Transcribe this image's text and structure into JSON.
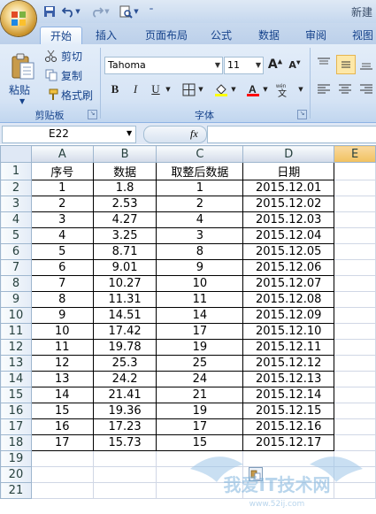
{
  "title_bar": {
    "title_partial": "新建"
  },
  "tabs": [
    {
      "label": "开始",
      "active": true
    },
    {
      "label": "插入"
    },
    {
      "label": "页面布局"
    },
    {
      "label": "公式"
    },
    {
      "label": "数据"
    },
    {
      "label": "审阅"
    },
    {
      "label": "视图"
    }
  ],
  "clipboard": {
    "paste_label": "粘贴",
    "cut_label": "剪切",
    "copy_label": "复制",
    "format_painter_label": "格式刷",
    "group_label": "剪贴板"
  },
  "font": {
    "name": "Tahoma",
    "size": "11",
    "group_label": "字体",
    "bold": "B",
    "italic": "I",
    "underline": "U",
    "font_color": "#ff0000",
    "fill_color": "#ffff00"
  },
  "formula_bar": {
    "name_box": "E22",
    "fx": "fx",
    "value": ""
  },
  "columns": [
    "A",
    "B",
    "C",
    "D",
    "E"
  ],
  "selected_column": "E",
  "row_numbers": [
    "1",
    "2",
    "3",
    "4",
    "5",
    "6",
    "7",
    "8",
    "9",
    "10",
    "11",
    "12",
    "13",
    "14",
    "15",
    "16",
    "17",
    "18",
    "19",
    "20",
    "21"
  ],
  "table": {
    "headers": [
      "序号",
      "数据",
      "取整后数据",
      "日期"
    ],
    "rows": [
      [
        "1",
        "1.8",
        "1",
        "2015.12.01"
      ],
      [
        "2",
        "2.53",
        "2",
        "2015.12.02"
      ],
      [
        "3",
        "4.27",
        "4",
        "2015.12.03"
      ],
      [
        "4",
        "3.25",
        "3",
        "2015.12.04"
      ],
      [
        "5",
        "8.71",
        "8",
        "2015.12.05"
      ],
      [
        "6",
        "9.01",
        "9",
        "2015.12.06"
      ],
      [
        "7",
        "10.27",
        "10",
        "2015.12.07"
      ],
      [
        "8",
        "11.31",
        "11",
        "2015.12.08"
      ],
      [
        "9",
        "14.51",
        "14",
        "2015.12.09"
      ],
      [
        "10",
        "17.42",
        "17",
        "2015.12.10"
      ],
      [
        "11",
        "19.78",
        "19",
        "2015.12.11"
      ],
      [
        "12",
        "25.3",
        "25",
        "2015.12.12"
      ],
      [
        "13",
        "24.2",
        "24",
        "2015.12.13"
      ],
      [
        "14",
        "21.41",
        "21",
        "2015.12.14"
      ],
      [
        "15",
        "19.36",
        "19",
        "2015.12.15"
      ],
      [
        "16",
        "17.23",
        "17",
        "2015.12.16"
      ],
      [
        "17",
        "15.73",
        "15",
        "2015.12.17"
      ]
    ]
  },
  "watermark": {
    "text": "我爱IT技术网",
    "url": "www.52ij.com"
  }
}
